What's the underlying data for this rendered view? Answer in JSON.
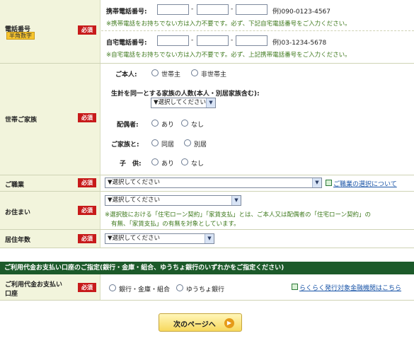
{
  "phone": {
    "label": "電話番号",
    "badge": "半角数字",
    "required": "必須",
    "mobile_label": "携帯電話番号:",
    "mobile_example": "例)090-0123-4567",
    "mobile_note": "※携帯電話をお持ちでない方は入力不要です。必ず、下記自宅電話番号をご入力ください。",
    "home_label": "自宅電話番号:",
    "home_example": "例)03-1234-5678",
    "home_note": "※自宅電話をお持ちでない方は入力不要です。必ず、上記携帯電話番号をご入力ください。",
    "dash": "-"
  },
  "household": {
    "label": "世帯ご家族",
    "required": "必須",
    "self_label": "ご本人:",
    "self_options": [
      "世帯主",
      "非世帯主"
    ],
    "count_label": "生計を同一とする家族の人数(本人・別居家族含む):",
    "count_select": "▼選択してください",
    "spouse_label": "配偶者:",
    "spouse_options": [
      "あり",
      "なし"
    ],
    "family_label": "ご家族と:",
    "family_options": [
      "同居",
      "別居"
    ],
    "child_label": "子　供:",
    "child_options": [
      "あり",
      "なし"
    ]
  },
  "occupation": {
    "label": "ご職業",
    "required": "必須",
    "select": "▼選択してください",
    "help_link": "ご職業の選択について"
  },
  "residence": {
    "label": "お住まい",
    "required": "必須",
    "select": "▼選択してください",
    "note_1": "※選択肢における「住宅ローン契約」「家賃支払」とは、ご本人又は配偶者の「住宅ローン契約」の",
    "note_2": "有無、「家賃支払」の有無を対象としています。"
  },
  "years": {
    "label": "居住年数",
    "required": "必須",
    "select": "▼選択してください"
  },
  "account": {
    "section_title": "ご利用代金お支払い口座のご指定(銀行・金庫・組合、ゆうちょ銀行のいずれかをご指定ください)",
    "label_1": "ご利用代金お支払い",
    "label_2": "口座",
    "required": "必須",
    "options": [
      "銀行・金庫・組合",
      "ゆうちょ銀行"
    ],
    "link": "らくらく発行対象金融機関はこちら"
  },
  "next_button": "次のページへ",
  "colors": {
    "label_bg": "#f2f4dc",
    "required": "#c71a1a",
    "note": "#3f7a1e",
    "section_header": "#1c5a2a",
    "link": "#1a55a8",
    "button": "#f7d85d"
  }
}
